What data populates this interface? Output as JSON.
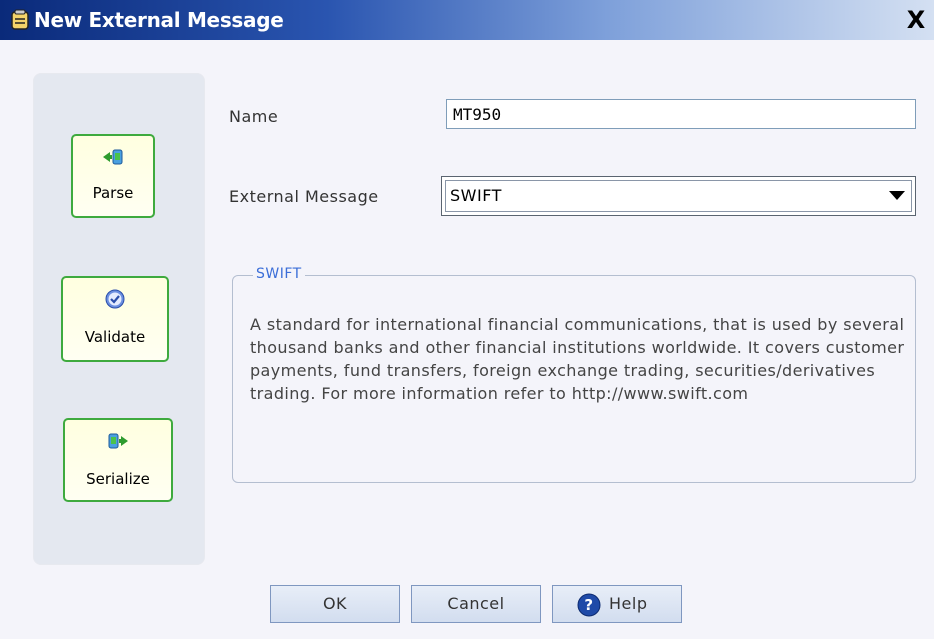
{
  "window": {
    "title": "New External Message",
    "close_label": "X"
  },
  "sidebar": {
    "parse": {
      "label": "Parse",
      "icon": "parse-icon"
    },
    "validate": {
      "label": "Validate",
      "icon": "validate-check-icon"
    },
    "serialize": {
      "label": "Serialize",
      "icon": "serialize-icon"
    }
  },
  "form": {
    "name_label": "Name",
    "name_value": "MT950",
    "external_message_label": "External Message",
    "external_message_value": "SWIFT"
  },
  "info": {
    "legend": "SWIFT",
    "description": "A standard for international financial communications, that is used by several thousand banks and other financial institutions worldwide. It covers customer payments, fund transfers, foreign exchange trading, securities/derivatives trading. For more information refer to http://www.swift.com"
  },
  "buttons": {
    "ok": "OK",
    "cancel": "Cancel",
    "help": "Help"
  },
  "colors": {
    "accent": "#3b6ed8",
    "button_border_green": "#3eaa3e",
    "title_dark": "#0a2a7a"
  }
}
